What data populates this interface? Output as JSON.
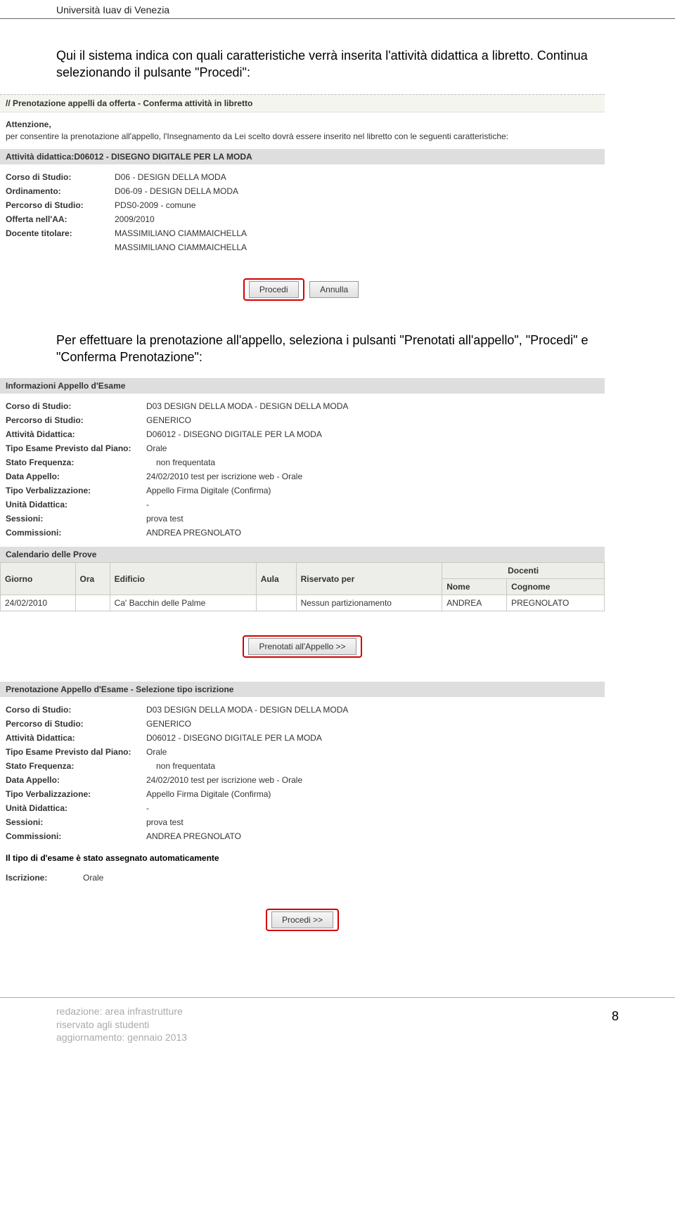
{
  "header": {
    "uni": "Università Iuav di Venezia"
  },
  "para1": "Qui il sistema indica con quali caratteristiche verrà inserita l'attività didattica a libretto. Continua selezionando il pulsante \"Procedi\":",
  "para2": "Per effettuare la prenotazione all'appello, seleziona i pulsanti \"Prenotati all'appello\", \"Procedi\" e \"Conferma Prenotazione\":",
  "panel1": {
    "title": "//  Prenotazione appelli da offerta - Conferma attività in libretto",
    "attn_label": "Attenzione,",
    "attn_text": "per consentire la prenotazione all'appello, l'Insegnamento da Lei scelto dovrà  essere inserito nel libretto con le seguenti caratteristiche:",
    "activity_bar": "Attività didattica:D06012 - DISEGNO DIGITALE PER LA MODA",
    "rows": [
      {
        "k": "Corso di Studio:",
        "v": "D06 - DESIGN DELLA MODA"
      },
      {
        "k": "Ordinamento:",
        "v": "D06-09 - DESIGN DELLA MODA"
      },
      {
        "k": "Percorso di Studio:",
        "v": "PDS0-2009 - comune"
      },
      {
        "k": "Offerta nell'AA:",
        "v": "2009/2010"
      },
      {
        "k": "Docente titolare:",
        "v": "MASSIMILIANO CIAMMAICHELLA"
      }
    ],
    "docente_extra": "MASSIMILIANO CIAMMAICHELLA",
    "btn_procedi": "Procedi",
    "btn_annulla": "Annulla"
  },
  "panel2": {
    "title": "Informazioni Appello d'Esame",
    "rows": [
      {
        "k": "Corso di Studio:",
        "v": "D03 DESIGN DELLA MODA - DESIGN DELLA MODA"
      },
      {
        "k": "Percorso di Studio:",
        "v": "GENERICO"
      },
      {
        "k": "Attività Didattica:",
        "v": "D06012 - DISEGNO DIGITALE PER LA MODA"
      },
      {
        "k": "Tipo Esame Previsto dal Piano:",
        "v": "Orale"
      },
      {
        "k": "Stato Frequenza:",
        "v": "non frequentata",
        "indent": true
      },
      {
        "k": "Data Appello:",
        "v": "24/02/2010 test per iscrizione web - Orale"
      },
      {
        "k": "Tipo Verbalizzazione:",
        "v": "Appello Firma Digitale (Confirma)"
      },
      {
        "k": "Unità Didattica:",
        "v": "-"
      },
      {
        "k": "Sessioni:",
        "v": "prova test"
      },
      {
        "k": "Commissioni:",
        "v": "ANDREA PREGNOLATO"
      }
    ],
    "calendar_title": "Calendario delle Prove",
    "table": {
      "headers": {
        "giorno": "Giorno",
        "ora": "Ora",
        "edificio": "Edificio",
        "aula": "Aula",
        "riservato": "Riservato per",
        "docenti": "Docenti",
        "nome": "Nome",
        "cognome": "Cognome"
      },
      "row": {
        "giorno": "24/02/2010",
        "ora": "",
        "edificio": "Ca' Bacchin delle Palme",
        "aula": "",
        "riservato": "Nessun partizionamento",
        "nome": "ANDREA",
        "cognome": "PREGNOLATO"
      }
    },
    "btn": "Prenotati all'Appello >>"
  },
  "panel3": {
    "title": "Prenotazione Appello d'Esame - Selezione tipo iscrizione",
    "rows": [
      {
        "k": "Corso di Studio:",
        "v": "D03 DESIGN DELLA MODA - DESIGN DELLA MODA"
      },
      {
        "k": "Percorso di Studio:",
        "v": "GENERICO"
      },
      {
        "k": "Attività Didattica:",
        "v": "D06012 - DISEGNO DIGITALE PER LA MODA"
      },
      {
        "k": "Tipo Esame Previsto dal Piano:",
        "v": "Orale"
      },
      {
        "k": "Stato Frequenza:",
        "v": "non frequentata",
        "indent": true
      },
      {
        "k": "Data Appello:",
        "v": "24/02/2010 test per iscrizione web - Orale"
      },
      {
        "k": "Tipo Verbalizzazione:",
        "v": "Appello Firma Digitale (Confirma)"
      },
      {
        "k": "Unità Didattica:",
        "v": "-"
      },
      {
        "k": "Sessioni:",
        "v": "prova test"
      },
      {
        "k": "Commissioni:",
        "v": "ANDREA PREGNOLATO"
      }
    ],
    "auto_text": "Il tipo di d'esame è stato assegnato automaticamente",
    "iscrizione_k": "Iscrizione:",
    "iscrizione_v": "Orale",
    "btn": "Procedi >>"
  },
  "footer": {
    "l1": "redazione: area infrastrutture",
    "l2": "riservato agli studenti",
    "l3": "aggiornamento: gennaio 2013",
    "page": "8"
  }
}
